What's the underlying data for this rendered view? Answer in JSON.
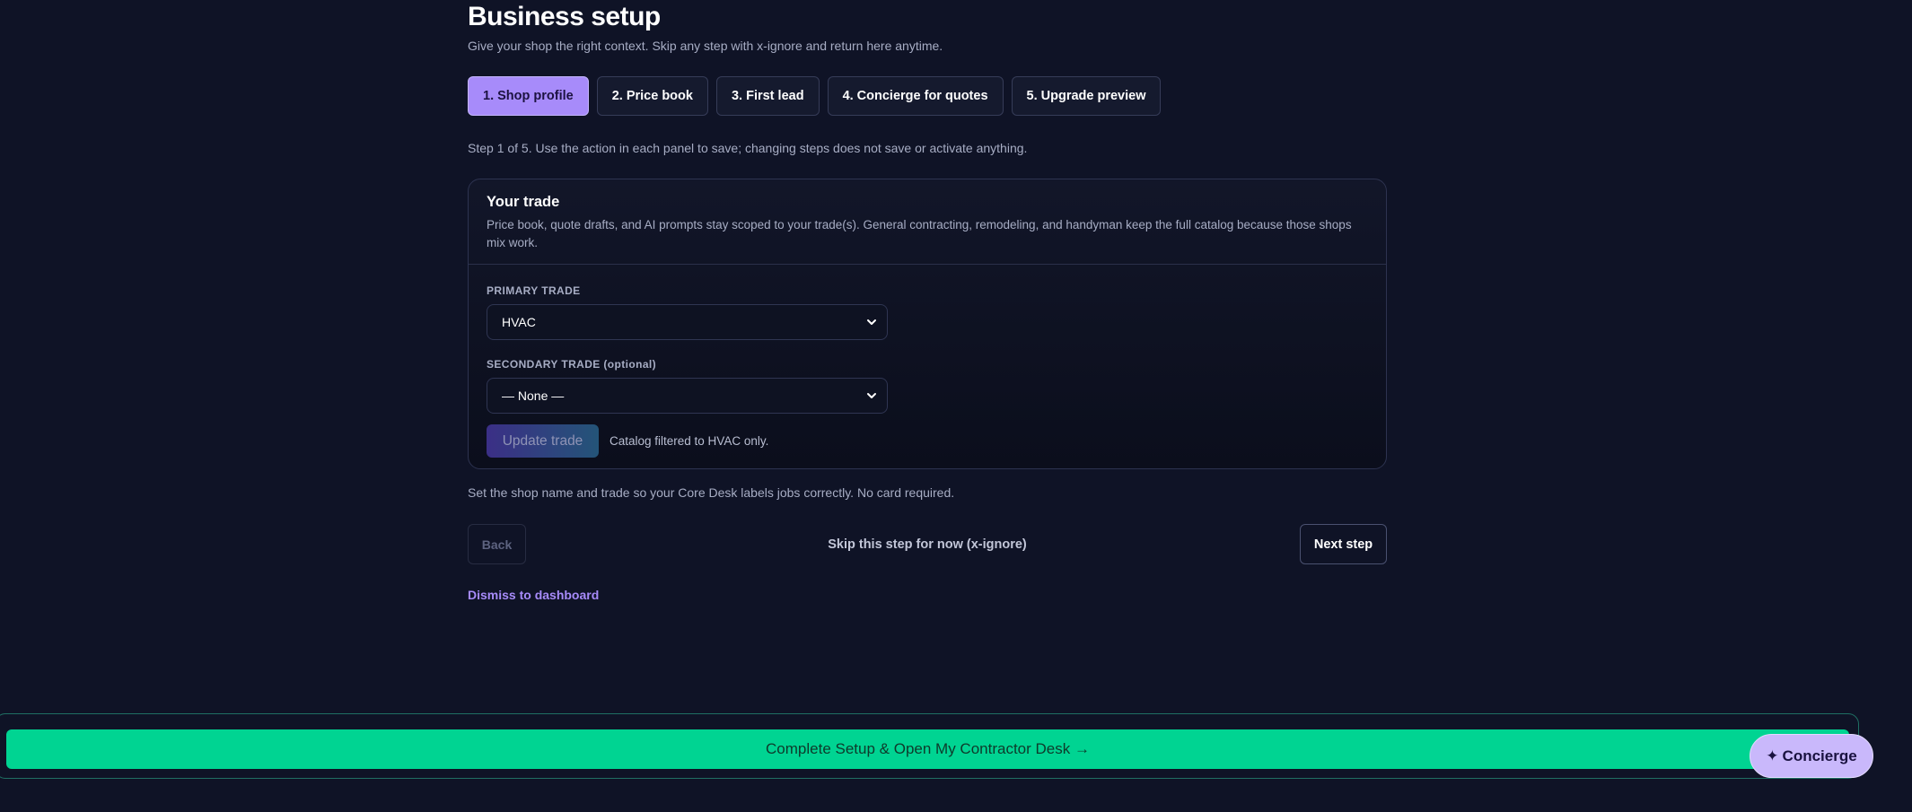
{
  "header": {
    "title": "Business setup",
    "subtitle": "Give your shop the right context. Skip any step with x-ignore and return here anytime."
  },
  "steps": [
    {
      "label": "1. Shop profile",
      "active": true
    },
    {
      "label": "2. Price book",
      "active": false
    },
    {
      "label": "3. First lead",
      "active": false
    },
    {
      "label": "4. Concierge for quotes",
      "active": false
    },
    {
      "label": "5. Upgrade preview",
      "active": false
    }
  ],
  "step_note": "Step 1 of 5. Use the action in each panel to save; changing steps does not save or activate anything.",
  "panel": {
    "title": "Your trade",
    "description": "Price book, quote drafts, and AI prompts stay scoped to your trade(s). General contracting, remodeling, and handyman keep the full catalog because those shops mix work.",
    "primary_label": "PRIMARY TRADE",
    "primary_value": "HVAC",
    "secondary_label": "SECONDARY TRADE (optional)",
    "secondary_value": "— None —",
    "update_button": "Update trade",
    "catalog_note": "Catalog filtered to HVAC only."
  },
  "foot_note": "Set the shop name and trade so your Core Desk labels jobs correctly. No card required.",
  "nav": {
    "back": "Back",
    "skip": "Skip this step for now (x-ignore)",
    "next": "Next step"
  },
  "dismiss": "Dismiss to dashboard",
  "cta": "Complete Setup & Open My Contractor Desk →",
  "concierge": {
    "icon": "✦",
    "label": "Concierge"
  },
  "colors": {
    "background": "#0f1326",
    "accent": "#a78bfa",
    "cta": "#00d492"
  }
}
